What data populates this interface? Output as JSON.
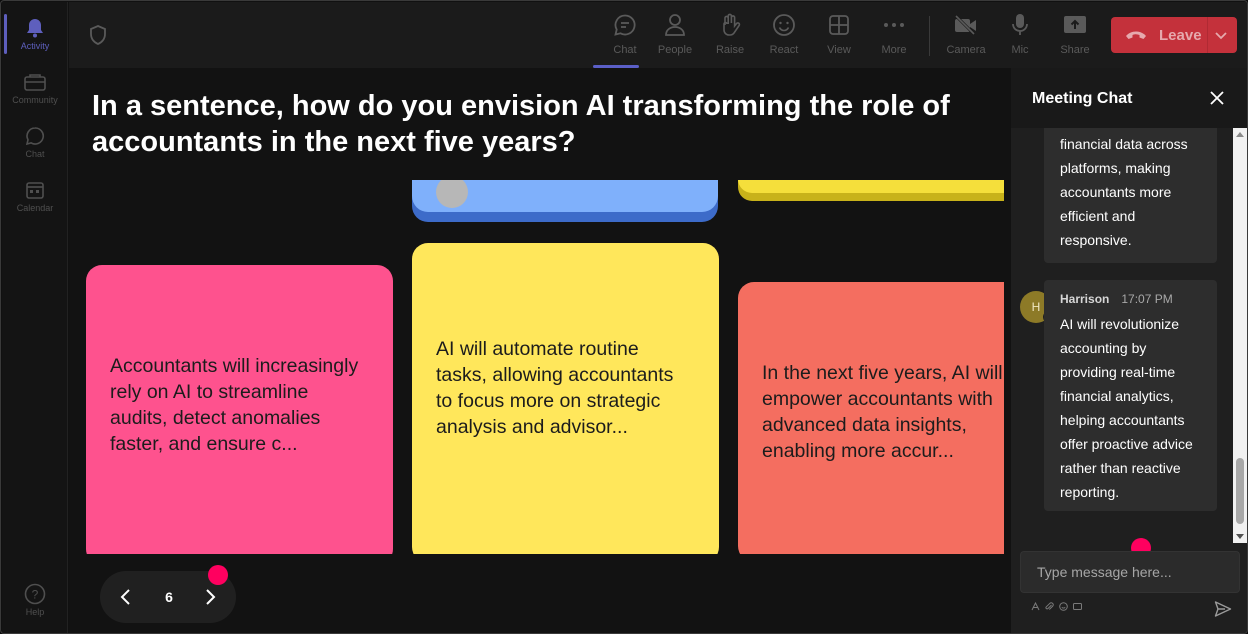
{
  "rail": {
    "items": [
      {
        "label": "Activity",
        "icon": "bell-icon",
        "active": true
      },
      {
        "label": "Community",
        "icon": "community-icon"
      },
      {
        "label": "Chat",
        "icon": "chat-icon"
      },
      {
        "label": "Calendar",
        "icon": "calendar-icon"
      }
    ],
    "help_label": "Help"
  },
  "toolbar": {
    "items": [
      {
        "label": "Chat",
        "icon": "chat-icon",
        "active": true
      },
      {
        "label": "People",
        "icon": "people-icon"
      },
      {
        "label": "Raise",
        "icon": "raise-hand-icon"
      },
      {
        "label": "React",
        "icon": "react-icon"
      },
      {
        "label": "View",
        "icon": "view-icon"
      },
      {
        "label": "More",
        "icon": "more-icon"
      },
      {
        "label": "Camera",
        "icon": "camera-off-icon"
      },
      {
        "label": "Mic",
        "icon": "mic-icon"
      },
      {
        "label": "Share",
        "icon": "share-icon"
      }
    ],
    "leave_label": "Leave"
  },
  "stage": {
    "question": "In a sentence, how do you envision AI transforming the role of accountants in the next five years?",
    "notes": [
      {
        "text": "Accountants will increasingly rely on AI to streamline audits, detect anomalies faster, and ensure c...",
        "color": "#fe528e"
      },
      {
        "text": "AI will automate routine tasks, allowing accountants to focus more on strategic analysis and advisor...",
        "color": "#ffe75b"
      },
      {
        "text": "In the next five years, AI will empower accountants with advanced data insights, enabling more accur...",
        "color": "#f46e60"
      }
    ],
    "page_number": "6"
  },
  "chat": {
    "title": "Meeting Chat",
    "messages": [
      {
        "text": "financial data across platforms, making accountants more efficient and responsive."
      },
      {
        "author": "Harrison",
        "time": "17:07 PM",
        "avatar_initial": "H",
        "text": "AI will revolutionize accounting by providing real-time financial analytics, helping accountants offer proactive advice rather than reactive reporting."
      }
    ],
    "compose_placeholder": "Type message here..."
  },
  "colors": {
    "accent": "#5b5fc7",
    "leave": "#c4313b",
    "notification_dot": "#ff005f"
  }
}
